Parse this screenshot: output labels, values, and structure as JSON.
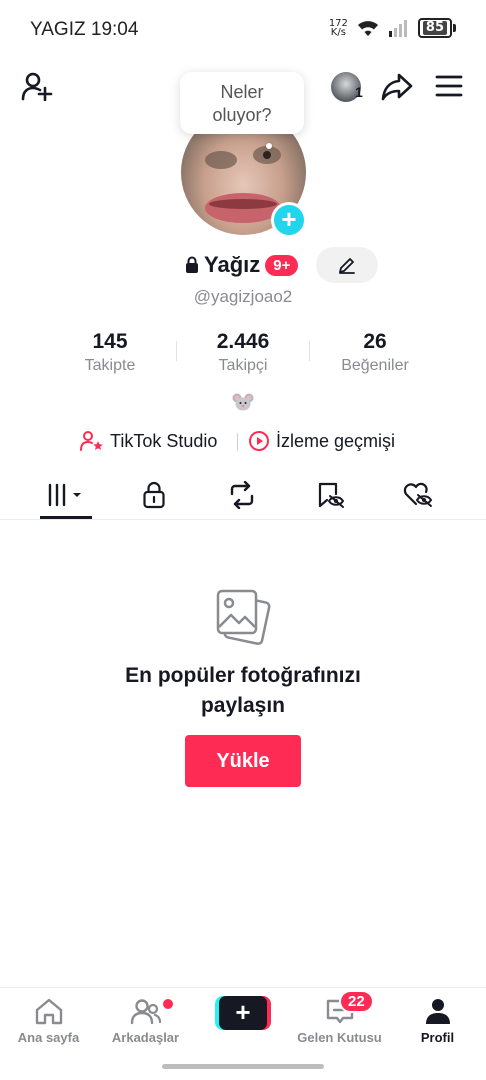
{
  "status_bar": {
    "carrier_time": "YAGIZ 19:04",
    "net_speed_value": "172",
    "net_speed_unit": "K/s",
    "battery": "85"
  },
  "header": {
    "bubble_text_line1": "Neler",
    "bubble_text_line2": "oluyor?",
    "notification_count": "1"
  },
  "profile": {
    "name": "Yağız",
    "name_badge": "9+",
    "handle": "@yagizjoao2"
  },
  "stats": [
    {
      "value": "145",
      "label": "Takipte"
    },
    {
      "value": "2.446",
      "label": "Takipçi"
    },
    {
      "value": "26",
      "label": "Beğeniler"
    }
  ],
  "bio_emoji": "🐭",
  "links": {
    "studio": "TikTok Studio",
    "history": "İzleme geçmişi"
  },
  "empty_state": {
    "title_line1": "En popüler fotoğrafınızı",
    "title_line2": "paylaşın",
    "button": "Yükle"
  },
  "bottom_nav": {
    "home": "Ana sayfa",
    "friends": "Arkadaşlar",
    "inbox": "Gelen Kutusu",
    "inbox_badge": "22",
    "profile": "Profil"
  },
  "colors": {
    "accent": "#fe2c55",
    "cyan": "#20d5ec",
    "text": "#161823",
    "muted": "#8a8b91"
  }
}
